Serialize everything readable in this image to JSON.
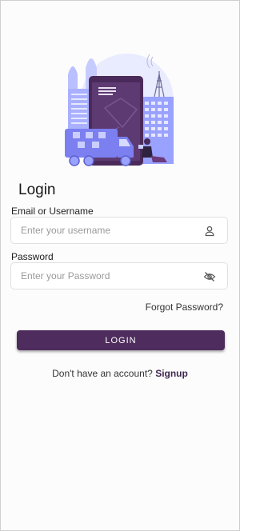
{
  "login": {
    "title": "Login",
    "email_label": "Email or Username",
    "email_placeholder": "Enter your username",
    "email_value": "",
    "password_label": "Password",
    "password_placeholder": "Enter your Password",
    "password_value": "",
    "forgot_password": "Forgot Password?",
    "login_button": "LOGIN",
    "signup_prompt": "Don't have an account?",
    "signup_link": "Signup"
  },
  "icons": {
    "username_field": "user-icon",
    "password_field": "eye-off-icon"
  },
  "colors": {
    "primary": "#4e2c5d",
    "illustration_accent": "#7b7ff0",
    "illustration_light": "#c9ceff"
  }
}
